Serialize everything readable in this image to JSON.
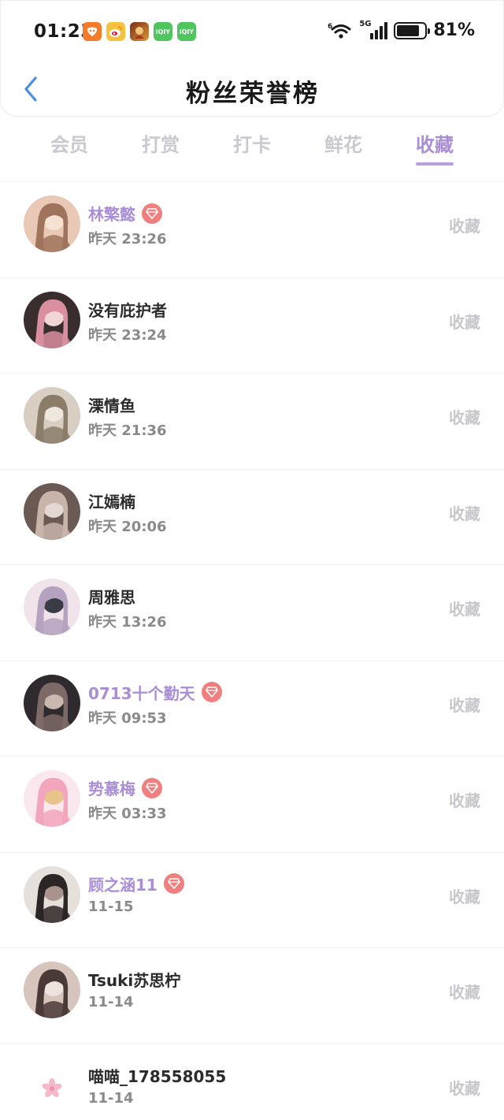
{
  "status_bar": {
    "time": "01:23",
    "notification_icons": [
      "taobao-icon",
      "weibo-icon",
      "game-icon",
      "iqiyi-icon",
      "iqiyi-icon"
    ],
    "iqiyi_label": "iQIY",
    "network": "5G",
    "battery_percent": "81%",
    "battery_level": 0.81
  },
  "header": {
    "back_icon": "chevron-left-icon",
    "title": "粉丝荣誉榜"
  },
  "tabs": [
    {
      "label": "会员",
      "active": false
    },
    {
      "label": "打赏",
      "active": false
    },
    {
      "label": "打卡",
      "active": false
    },
    {
      "label": "鲜花",
      "active": false
    },
    {
      "label": "收藏",
      "active": true
    }
  ],
  "fans": [
    {
      "name": "林檠懿",
      "time": "昨天 23:26",
      "vip": true,
      "action": "收藏"
    },
    {
      "name": "没有庇护者",
      "time": "昨天 23:24",
      "vip": false,
      "action": "收藏"
    },
    {
      "name": "溧情鱼",
      "time": "昨天 21:36",
      "vip": false,
      "action": "收藏"
    },
    {
      "name": "江嫣楠",
      "time": "昨天 20:06",
      "vip": false,
      "action": "收藏"
    },
    {
      "name": "周雅思",
      "time": "昨天 13:26",
      "vip": false,
      "action": "收藏"
    },
    {
      "name": "0713十个勤天",
      "time": "昨天 09:53",
      "vip": true,
      "action": "收藏"
    },
    {
      "name": "势慕梅",
      "time": "昨天 03:33",
      "vip": true,
      "action": "收藏"
    },
    {
      "name": "顾之涵11",
      "time": "11-15",
      "vip": true,
      "action": "收藏"
    },
    {
      "name": "Tsuki苏思柠",
      "time": "11-14",
      "vip": false,
      "action": "收藏"
    },
    {
      "name": "喵喵_178558055",
      "time": "11-14",
      "vip": false,
      "action": "收藏"
    }
  ],
  "colors": {
    "accent": "#a98ed6",
    "back_arrow": "#4a90e2",
    "vip_badge": "#f07f7f",
    "muted": "#c8c8cc"
  }
}
